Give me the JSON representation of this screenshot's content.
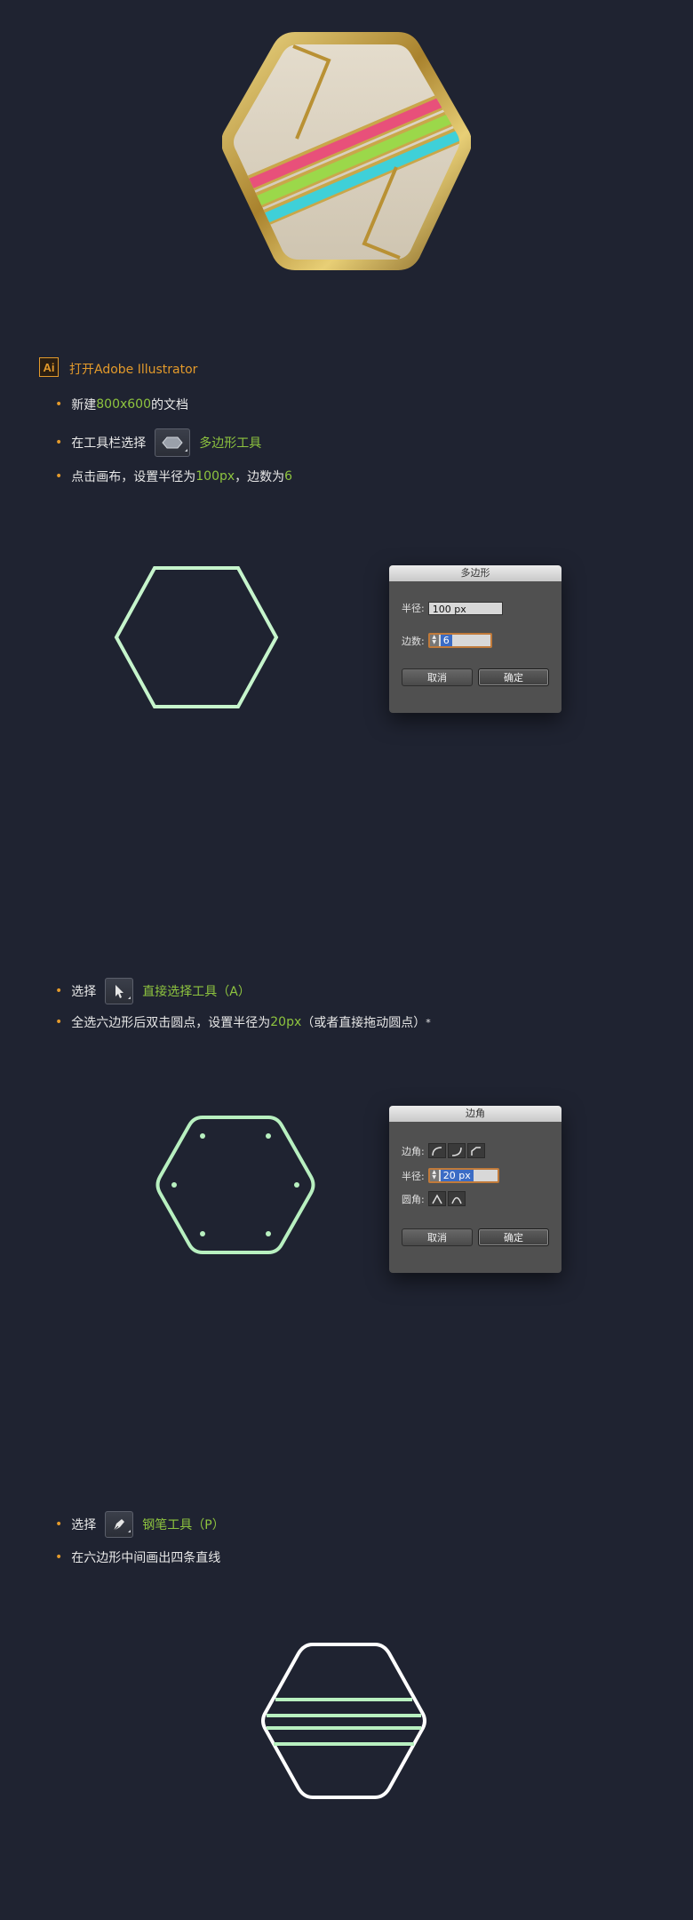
{
  "section1": {
    "app_name": "打开Adobe Illustrator",
    "ai_logo_text": "Ai",
    "step1": {
      "prefix": "新建 ",
      "size": "800x600",
      "suffix": " 的文档"
    },
    "step2": {
      "prefix": "在工具栏选择",
      "tool": "多边形工具"
    },
    "step3": {
      "prefix": "点击画布，设置半径为",
      "radius": "100px",
      "mid": "，边数为",
      "sides": "6"
    }
  },
  "polygon_dialog": {
    "title": "多边形",
    "radius_label": "半径:",
    "radius_value": "100 px",
    "sides_label": "边数:",
    "sides_value": "6",
    "cancel": "取消",
    "ok": "确定"
  },
  "section2": {
    "step1": {
      "prefix": "选择",
      "tool": "直接选择工具（A）"
    },
    "step2": {
      "prefix": "全选六边形后双击圆点，设置半径为",
      "radius": "20px",
      "suffix": "（或者直接拖动圆点）",
      "mark": "*"
    }
  },
  "corner_dialog": {
    "title": "边角",
    "corner_label": "边角:",
    "radius_label": "半径:",
    "radius_value": "20 px",
    "rounding_label": "圆角:",
    "cancel": "取消",
    "ok": "确定"
  },
  "section3": {
    "step1": {
      "prefix": "选择",
      "tool": "钢笔工具（P）"
    },
    "step2": {
      "text": "在六边形中间画出四条直线"
    }
  },
  "colors": {
    "background": "#1f2331",
    "accent_orange": "#e39a2b",
    "accent_green": "#8ec43f",
    "shape_green": "#b8f0c0",
    "badge_pink": "#e8507a",
    "badge_green": "#9bd84a",
    "badge_cyan": "#3fd0d8",
    "badge_gold": "#c9a74a"
  },
  "icons": [
    "hexagon-badge-icon",
    "polygon-tool-icon",
    "direct-select-icon",
    "pen-tool-icon",
    "corner-icon",
    "rounding-icon"
  ]
}
